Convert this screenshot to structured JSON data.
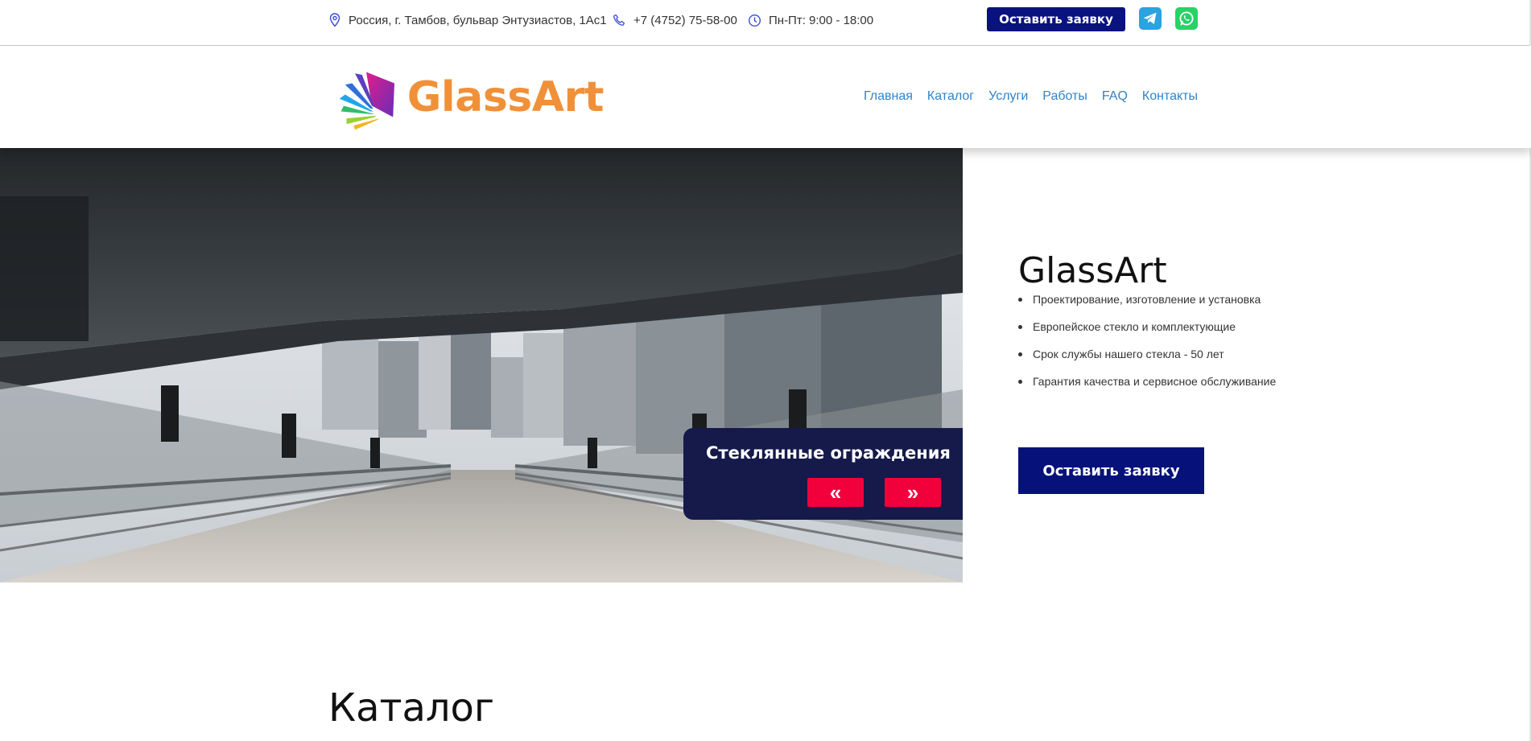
{
  "topbar": {
    "address": "Россия, г. Тамбов, бульвар Энтузиастов, 1Ас1",
    "phone": "+7 (4752) 75-58-00",
    "hours": "Пн-Пт: 9:00 - 18:00",
    "request_button": "Оставить заявку",
    "socials": [
      "telegram-icon",
      "whatsapp-icon"
    ]
  },
  "header": {
    "logo_text": "GlassArt",
    "nav": [
      "Главная",
      "Каталог",
      "Услуги",
      "Работы",
      "FAQ",
      "Контакты"
    ]
  },
  "hero": {
    "slide_caption": "Стеклянные ограждения",
    "prev": "«",
    "next": "»",
    "brand_title": "GlassArt",
    "features": [
      "Проектирование, изготовление и установка",
      "Европейское стекло и комплектующие",
      "Срок службы нашего стекла - 50 лет",
      "Гарантия качества и сервисное обслуживание"
    ],
    "request_button": "Оставить заявку"
  },
  "catalog": {
    "title": "Каталог"
  },
  "colors": {
    "primary_navy": "#06127a",
    "accent_red": "#f2003c",
    "logo_orange": "#f0913a",
    "nav_blue": "#2f83c9",
    "slide_box": "#151a4a"
  }
}
